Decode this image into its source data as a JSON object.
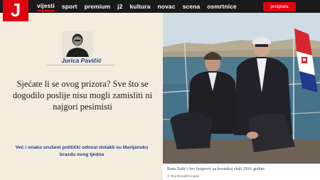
{
  "header": {
    "logo_letter": "J",
    "nav": [
      "vijesti",
      "sport",
      "premium",
      "j2",
      "kultura",
      "novac",
      "scena",
      "osmrtnice"
    ],
    "subscribe_label": "pretplata"
  },
  "article": {
    "author": "Jurica Pavičić",
    "headline": "Sjećate li se ovog prizora? Sve što se dogodilo poslije nisu mogli zamisliti ni najgori pesimisti",
    "lead": "Već i onako urušeni politički odnosi dotakli su Marijansku brazdu ovog tjedna"
  },
  "photo": {
    "caption": "Boris Tadić i Ivo Josipović na hrvatskoj obali 2010. godine",
    "credit": "© Tea Dimašć/cropix/"
  },
  "colors": {
    "brand_red": "#e3000f",
    "nav_bg": "#1a1a1a",
    "accent_blue": "#1f3f8f",
    "panel_bg": "#f3ecdf"
  }
}
